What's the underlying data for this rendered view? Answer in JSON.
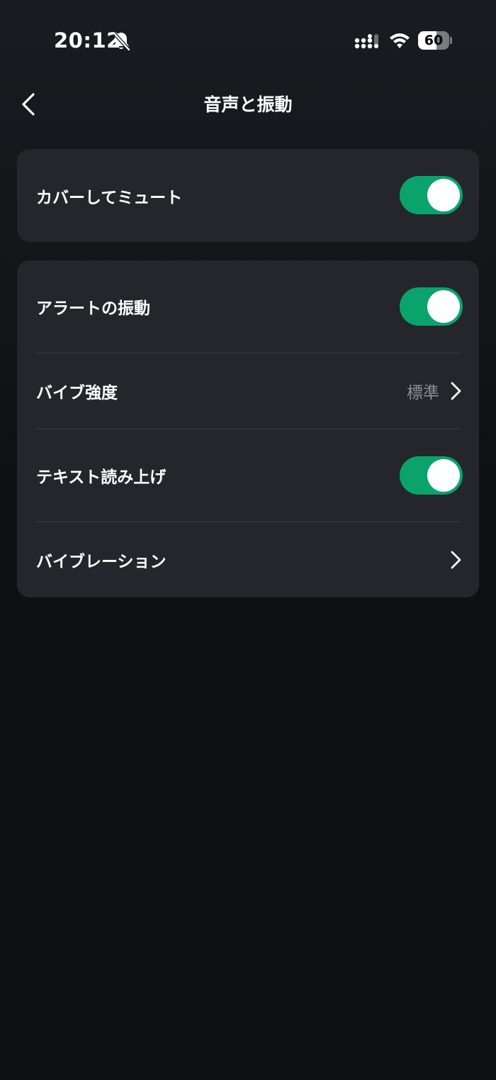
{
  "status_bar": {
    "time": "20:12",
    "battery_level": "60",
    "battery_fraction": 0.6,
    "icons": [
      "bell-slash-icon",
      "signal-icon",
      "wifi-icon",
      "battery-icon"
    ]
  },
  "nav": {
    "title": "音声と振動",
    "back_icon": "chevron-left-icon"
  },
  "groups": [
    {
      "rows": [
        {
          "label": "カバーしてミュート",
          "type": "toggle",
          "on": true
        }
      ]
    },
    {
      "rows": [
        {
          "label": "アラートの振動",
          "type": "toggle",
          "on": true
        },
        {
          "label": "バイブ強度",
          "type": "link",
          "value": "標準"
        },
        {
          "label": "テキスト読み上げ",
          "type": "toggle",
          "on": true
        },
        {
          "label": "バイブレーション",
          "type": "link"
        }
      ]
    }
  ],
  "colors": {
    "background": "#0f1014",
    "card": "#24262b",
    "toggle_on": "#0aa36c",
    "secondary_text": "#8e8f93",
    "divider": "#3a3c42"
  }
}
